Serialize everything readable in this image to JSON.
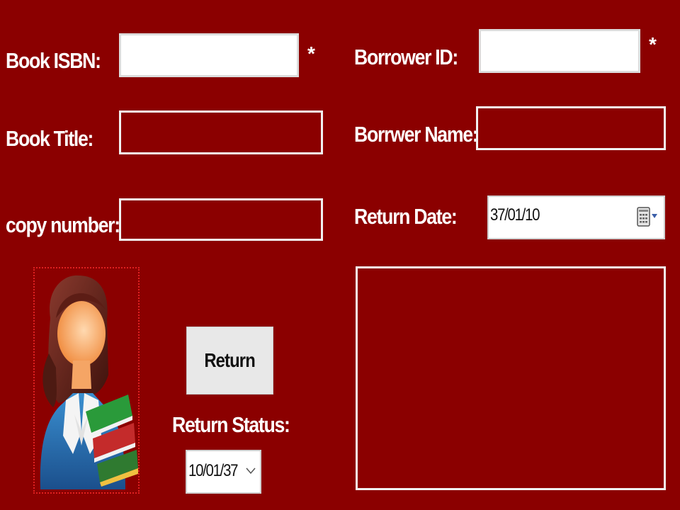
{
  "form": {
    "book_isbn_label": "Book ISBN:",
    "book_title_label": "Book Title:",
    "copy_number_label": "copy number:",
    "borrower_id_label": "Borrower ID:",
    "borrower_name_label": "Borrwer Name:",
    "return_date_label": "Return Date:",
    "required_marker": "*",
    "book_isbn_value": "",
    "book_title_value": "",
    "copy_number_value": "",
    "borrower_id_value": "",
    "borrower_name_value": "",
    "return_date_value": "37/01/10",
    "notes_value": ""
  },
  "actions": {
    "return_label": "Return"
  },
  "status": {
    "label": "Return Status:",
    "selected": "10/01/37"
  },
  "icons": {
    "calendar": "calendar-icon",
    "dropdown": "chevron-down-icon",
    "avatar": "librarian-avatar-icon"
  },
  "colors": {
    "background": "#8b0000",
    "field_border": "#f1f1f1",
    "frame_border": "#e02020"
  }
}
